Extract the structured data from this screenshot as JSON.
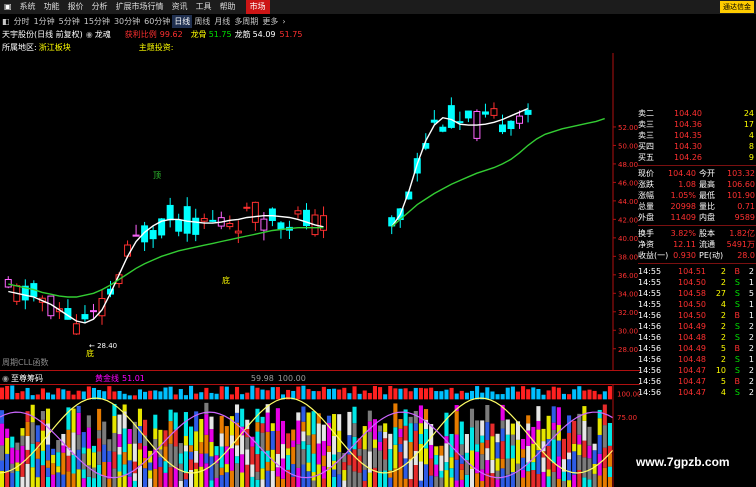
{
  "menu": {
    "items": [
      "系统",
      "功能",
      "报价",
      "分析",
      "扩展市场行情",
      "资讯",
      "工具",
      "帮助"
    ],
    "market_label": "市场",
    "corner_label": "通达信金"
  },
  "periods": {
    "items": [
      "分时",
      "1分钟",
      "5分钟",
      "15分钟",
      "30分钟",
      "60分钟",
      "日线",
      "周线",
      "月线",
      "多周期",
      "更多"
    ],
    "active_index": 6
  },
  "stock_line": {
    "name": "天宇股份(日线 前复权)",
    "indicator": "龙魂",
    "label1": "获利比例",
    "value1": "99.62",
    "label2": "龙骨",
    "value2": "51.75",
    "label3": "龙筋",
    "value3": "54.09",
    "value4": "51.75"
  },
  "info_line": {
    "region_label": "所属地区:",
    "region_value": "浙江板块",
    "theme_label": "主题投资:"
  },
  "chart_data": [
    {
      "type": "candlestick",
      "title": "天宇股份(日线 前复权)",
      "ylim": [
        27,
        60
      ],
      "y_ticks": [
        "52.00",
        "50.00",
        "48.00",
        "46.00",
        "44.00",
        "42.00",
        "40.00",
        "38.00",
        "36.00",
        "34.00",
        "32.00",
        "30.00",
        "28.00"
      ],
      "annotations": [
        "顶",
        "底",
        "底",
        "← 28.40"
      ],
      "footer_label": "周期CLL函数",
      "series": [
        {
          "name": "",
          "color": "#ffffff",
          "values": [
            34.2,
            34.0,
            33.8,
            33.6,
            33.2,
            32.8,
            32.2,
            31.6,
            31.0,
            30.8,
            31.2,
            32.2,
            34.0,
            36.0,
            38.0,
            39.6,
            40.6,
            41.3,
            41.8,
            42.0,
            42.0,
            41.8,
            41.7,
            41.6,
            41.6,
            41.7,
            41.9,
            42.0,
            42.2,
            42.3,
            42.4,
            42.4,
            42.3,
            42.2,
            42.0,
            41.7,
            41.4,
            41.2,
            null,
            null,
            null,
            null,
            null,
            null,
            null,
            41.2,
            42.5,
            45.0,
            48.0,
            50.5,
            52.2,
            53.0,
            52.8,
            52.3,
            52.2,
            52.2,
            52.3,
            52.5,
            52.8,
            53.2,
            53.6,
            54.0,
            null,
            null,
            null,
            null,
            null,
            null,
            null,
            null,
            null
          ]
        },
        {
          "name": "",
          "color": "#33cc33",
          "values": [
            35.0,
            34.8,
            34.6,
            34.4,
            34.1,
            33.9,
            33.7,
            33.6,
            33.6,
            33.8,
            34.0,
            34.4,
            34.9,
            35.5,
            36.1,
            36.7,
            37.2,
            37.6,
            38.0,
            38.3,
            38.6,
            38.8,
            39.0,
            39.2,
            39.4,
            39.6,
            39.8,
            40.0,
            40.2,
            40.4,
            40.6,
            40.8,
            40.9,
            41.0,
            41.1,
            41.1,
            41.1,
            41.1,
            null,
            null,
            null,
            null,
            null,
            null,
            null,
            41.2,
            42.0,
            42.8,
            43.6,
            44.2,
            44.8,
            45.3,
            45.8,
            46.2,
            46.6,
            47.0,
            47.3,
            47.6,
            48.0,
            48.5,
            49.2,
            50.0,
            50.7,
            51.2,
            51.5,
            51.8,
            52.0,
            52.2,
            52.4,
            52.6,
            52.9
          ]
        }
      ]
    },
    {
      "type": "bar",
      "title": "至尊筹码",
      "label1": "黄金线",
      "value1": "51.01",
      "value2": "59.98",
      "value3": "100.00",
      "y_ticks": [
        "100.00",
        "75.00"
      ],
      "ylim": [
        0,
        110
      ]
    }
  ],
  "quotes": {
    "asks": [
      {
        "label": "卖二",
        "price": "104.40",
        "vol": "24"
      },
      {
        "label": "卖三",
        "price": "104.36",
        "vol": "17"
      },
      {
        "label": "卖三",
        "price": "104.35",
        "vol": "4"
      },
      {
        "label": "买四",
        "price": "104.30",
        "vol": "8"
      },
      {
        "label": "买五",
        "price": "104.26",
        "vol": "9"
      }
    ],
    "stats": [
      {
        "l1": "现价",
        "v1": "104.40",
        "l2": "今开",
        "v2": "103.32"
      },
      {
        "l1": "涨跌",
        "v1": "1.08",
        "l2": "最高",
        "v2": "106.60"
      },
      {
        "l1": "涨幅",
        "v1": "1.05%",
        "l2": "最低",
        "v2": "101.90"
      },
      {
        "l1": "总量",
        "v1": "20998",
        "l2": "量比",
        "v2": "0.71"
      },
      {
        "l1": "外盘",
        "v1": "11409",
        "l2": "内盘",
        "v2": "9589"
      }
    ],
    "stats2": [
      {
        "l1": "换手",
        "v1": "3.82%",
        "l2": "股本",
        "v2": "1.82亿"
      },
      {
        "l1": "净资",
        "v1": "12.11",
        "l2": "流通",
        "v2": "5491万"
      },
      {
        "l1": "收益(一)",
        "v1": "0.930",
        "l2": "PE(动)",
        "v2": "28.0"
      }
    ]
  },
  "trades": [
    {
      "time": "14:55",
      "price": "104.51",
      "vol": "2",
      "side": "B",
      "n": "2"
    },
    {
      "time": "14:55",
      "price": "104.50",
      "vol": "2",
      "side": "S",
      "n": "1"
    },
    {
      "time": "14:55",
      "price": "104.58",
      "vol": "27",
      "side": "S",
      "n": "5"
    },
    {
      "time": "14:55",
      "price": "104.50",
      "vol": "4",
      "side": "S",
      "n": "1"
    },
    {
      "time": "14:56",
      "price": "104.50",
      "vol": "2",
      "side": "B",
      "n": "1"
    },
    {
      "time": "14:56",
      "price": "104.49",
      "vol": "2",
      "side": "S",
      "n": "2"
    },
    {
      "time": "14:56",
      "price": "104.48",
      "vol": "2",
      "side": "S",
      "n": "2"
    },
    {
      "time": "14:56",
      "price": "104.49",
      "vol": "5",
      "side": "B",
      "n": "2"
    },
    {
      "time": "14:56",
      "price": "104.48",
      "vol": "2",
      "side": "S",
      "n": "1"
    },
    {
      "time": "14:56",
      "price": "104.47",
      "vol": "10",
      "side": "S",
      "n": "2"
    },
    {
      "time": "14:56",
      "price": "104.47",
      "vol": "5",
      "side": "B",
      "n": "2"
    },
    {
      "time": "14:56",
      "price": "104.47",
      "vol": "4",
      "side": "S",
      "n": "2"
    }
  ],
  "colors": {
    "up": "#ff3030",
    "down": "#00ffff",
    "ma_white": "#ffffff",
    "ma_green": "#33cc33",
    "axis_red": "#b01010"
  },
  "watermark": "www.7gpzb.com"
}
